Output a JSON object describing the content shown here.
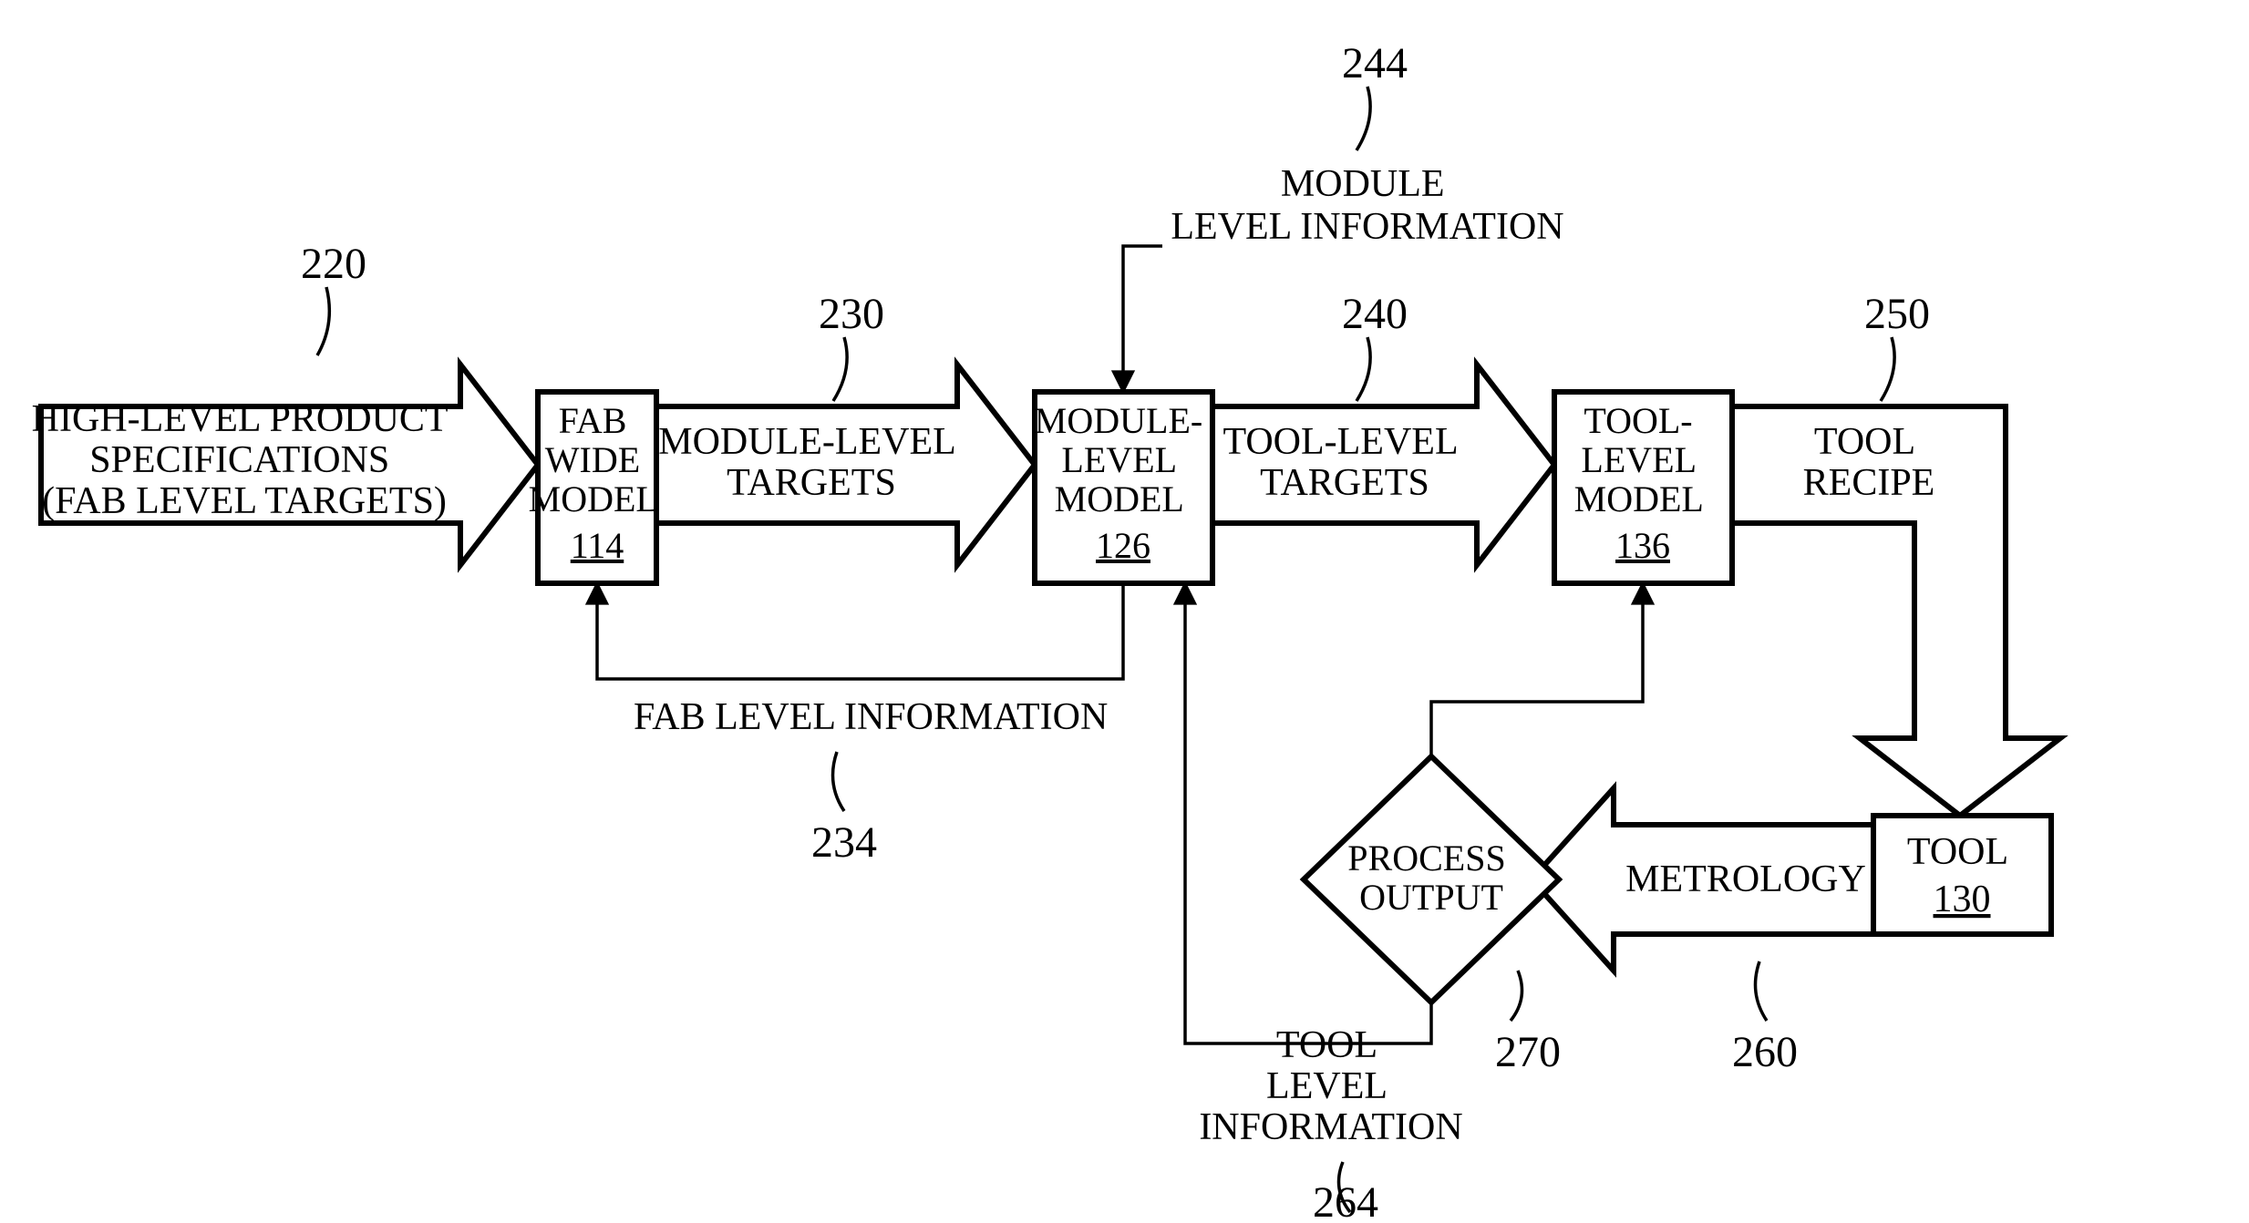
{
  "nodes": {
    "spec": {
      "line1": "HIGH-LEVEL PRODUCT",
      "line2": "SPECIFICATIONS",
      "line3": "(FAB LEVEL TARGETS)"
    },
    "fabModel": {
      "line1": "FAB",
      "line2": "WIDE",
      "line3": "MODEL",
      "ref": "114"
    },
    "modTargets": {
      "line1": "MODULE-LEVEL",
      "line2": "TARGETS"
    },
    "modModel": {
      "line1": "MODULE-",
      "line2": "LEVEL",
      "line3": "MODEL",
      "ref": "126"
    },
    "toolTargets": {
      "line1": "TOOL-LEVEL",
      "line2": "TARGETS"
    },
    "toolModel": {
      "line1": "TOOL-",
      "line2": "LEVEL",
      "line3": "MODEL",
      "ref": "136"
    },
    "toolRecipe": {
      "line1": "TOOL",
      "line2": "RECIPE"
    },
    "tool": {
      "line1": "TOOL",
      "ref": "130"
    },
    "metrology": {
      "line1": "METROLOGY"
    },
    "procOut": {
      "line1": "PROCESS",
      "line2": "OUTPUT"
    }
  },
  "labels": {
    "moduleInfo": {
      "line1": "MODULE",
      "line2": "LEVEL INFORMATION"
    },
    "fabInfo": {
      "line1": "FAB LEVEL INFORMATION"
    },
    "toolInfo": {
      "line1": "TOOL",
      "line2": "LEVEL",
      "line3": "INFORMATION"
    }
  },
  "refs": {
    "r220": "220",
    "r230": "230",
    "r234": "234",
    "r240": "240",
    "r244": "244",
    "r250": "250",
    "r260": "260",
    "r264": "264",
    "r270": "270"
  }
}
